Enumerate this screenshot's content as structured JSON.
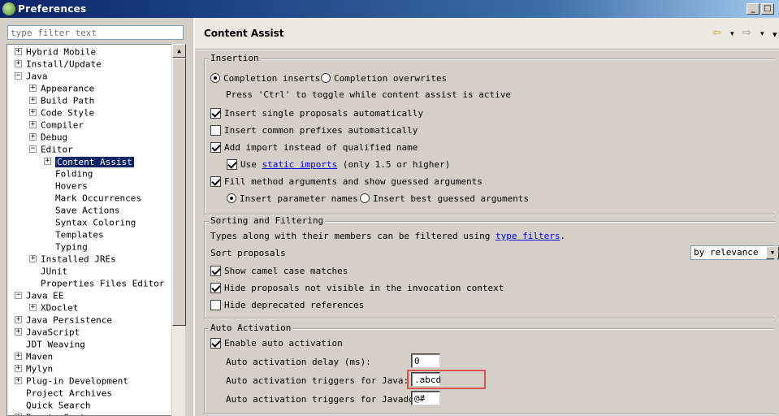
{
  "window": {
    "title": "Preferences",
    "minimize": "_",
    "maximize": "□"
  },
  "filter": {
    "placeholder": "type filter text"
  },
  "tree": [
    {
      "label": "Hybrid Mobile",
      "toggle": "+",
      "indent": 0
    },
    {
      "label": "Install/Update",
      "toggle": "+",
      "indent": 0
    },
    {
      "label": "Java",
      "toggle": "−",
      "indent": 0
    },
    {
      "label": "Appearance",
      "toggle": "+",
      "indent": 1
    },
    {
      "label": "Build Path",
      "toggle": "+",
      "indent": 1
    },
    {
      "label": "Code Style",
      "toggle": "+",
      "indent": 1
    },
    {
      "label": "Compiler",
      "toggle": "+",
      "indent": 1
    },
    {
      "label": "Debug",
      "toggle": "+",
      "indent": 1
    },
    {
      "label": "Editor",
      "toggle": "−",
      "indent": 1
    },
    {
      "label": "Content Assist",
      "toggle": "+",
      "indent": 2,
      "selected": true
    },
    {
      "label": "Folding",
      "toggle": "",
      "indent": 2
    },
    {
      "label": "Hovers",
      "toggle": "",
      "indent": 2
    },
    {
      "label": "Mark Occurrences",
      "toggle": "",
      "indent": 2
    },
    {
      "label": "Save Actions",
      "toggle": "",
      "indent": 2
    },
    {
      "label": "Syntax Coloring",
      "toggle": "",
      "indent": 2
    },
    {
      "label": "Templates",
      "toggle": "",
      "indent": 2
    },
    {
      "label": "Typing",
      "toggle": "",
      "indent": 2
    },
    {
      "label": "Installed JREs",
      "toggle": "+",
      "indent": 1
    },
    {
      "label": "JUnit",
      "toggle": "",
      "indent": 1
    },
    {
      "label": "Properties Files Editor",
      "toggle": "",
      "indent": 1
    },
    {
      "label": "Java EE",
      "toggle": "−",
      "indent": 0
    },
    {
      "label": "XDoclet",
      "toggle": "+",
      "indent": 1
    },
    {
      "label": "Java Persistence",
      "toggle": "+",
      "indent": 0
    },
    {
      "label": "JavaScript",
      "toggle": "+",
      "indent": 0
    },
    {
      "label": "JDT Weaving",
      "toggle": "",
      "indent": 0
    },
    {
      "label": "Maven",
      "toggle": "+",
      "indent": 0
    },
    {
      "label": "Mylyn",
      "toggle": "+",
      "indent": 0
    },
    {
      "label": "Plug-in Development",
      "toggle": "+",
      "indent": 0
    },
    {
      "label": "Project Archives",
      "toggle": "",
      "indent": 0
    },
    {
      "label": "Quick Search",
      "toggle": "",
      "indent": 0
    },
    {
      "label": "Remote Systems",
      "toggle": "+",
      "indent": 0
    }
  ],
  "page": {
    "title": "Content Assist",
    "nav_back": "⇦",
    "nav_forward": "⇨",
    "nav_menu": "▾"
  },
  "insertion": {
    "title": "Insertion",
    "completion_inserts": "Completion inserts",
    "completion_overwrites": "Completion overwrites",
    "ctrl_hint": "Press 'Ctrl' to toggle while content assist is active",
    "insert_single": "Insert single proposals automatically",
    "insert_common": "Insert common prefixes automatically",
    "add_import": "Add import instead of qualified name",
    "use_label": "Use",
    "static_imports_link": "static imports",
    "use_suffix": "(only 1.5 or higher)",
    "fill_method": "Fill method arguments and show guessed arguments",
    "insert_param_names": "Insert parameter names",
    "insert_best_guessed": "Insert best guessed arguments"
  },
  "sorting": {
    "title": "Sorting and Filtering",
    "types_text": "Types along with their members can be filtered using",
    "type_filters_link": "type filters",
    "period": ".",
    "sort_label": "Sort proposals",
    "sort_value": "by relevance",
    "camel_case": "Show camel case matches",
    "hide_not_visible": "Hide proposals not visible in the invocation context",
    "hide_deprecated": "Hide deprecated references"
  },
  "activation": {
    "title": "Auto Activation",
    "enable": "Enable auto activation",
    "delay_label": "Auto activation delay (ms):",
    "delay_value": "0",
    "java_label": "Auto activation triggers for Java:",
    "java_value": ".abcd",
    "javadoc_label": "Auto activation triggers for Javadoc:",
    "javadoc_value": "@#"
  },
  "colors": {
    "selection": "#0a246a",
    "highlight": "#d9534f",
    "link": "#0000ee"
  }
}
